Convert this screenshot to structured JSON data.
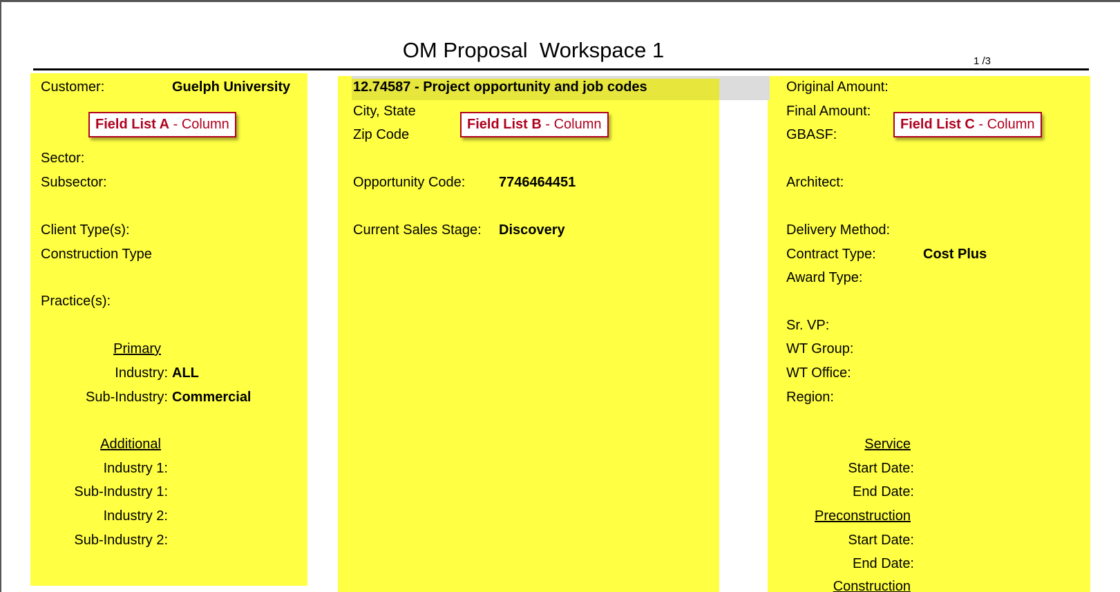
{
  "header": {
    "title": "OM Proposal  Workspace 1",
    "page_indicator": "1 /3"
  },
  "callouts": {
    "a": {
      "strong": "Field List A",
      "rest": " - Column"
    },
    "b": {
      "strong": "Field List B",
      "rest": " - Column"
    },
    "c": {
      "strong": "Field List C",
      "rest": " - Column"
    }
  },
  "column_a": {
    "customer_label": "Customer:",
    "customer_value": "Guelph University",
    "sector_label": "Sector:",
    "subsector_label": "Subsector:",
    "client_types_label": "Client Type(s):",
    "construction_type_label": "Construction Type",
    "practices_label": "Practice(s):",
    "primary_heading": "Primary",
    "industry_label": "Industry:",
    "industry_value": "ALL",
    "sub_industry_label": "Sub-Industry:",
    "sub_industry_value": "Commercial",
    "additional_heading": "Additional",
    "industry1_label": "Industry 1:",
    "sub_industry1_label": "Sub-Industry 1:",
    "industry2_label": "Industry 2:",
    "sub_industry2_label": "Sub-Industry 2:"
  },
  "column_b": {
    "project_heading": "12.74587 - Project opportunity and job codes",
    "city_state_label": "City, State",
    "zip_label": "Zip Code",
    "opportunity_code_label": "Opportunity Code:",
    "opportunity_code_value": "7746464451",
    "sales_stage_label": "Current Sales Stage:",
    "sales_stage_value": "Discovery"
  },
  "column_c": {
    "original_amount_label": "Original Amount:",
    "final_amount_label": "Final Amount:",
    "gbasf_label": "GBASF:",
    "architect_label": "Architect:",
    "delivery_method_label": "Delivery Method:",
    "contract_type_label": "Contract Type:",
    "contract_type_value": "Cost Plus",
    "award_type_label": "Award Type:",
    "sr_vp_label": "Sr. VP:",
    "wt_group_label": "WT Group:",
    "wt_office_label": "WT Office:",
    "region_label": "Region:",
    "service_heading": "Service",
    "service_start_label": "Start Date:",
    "service_end_label": "End Date:",
    "precon_heading": "Preconstruction",
    "precon_start_label": "Start Date:",
    "precon_end_label": "End Date:",
    "construction_heading": "Construction"
  },
  "colors": {
    "column_fill": "#ffff44",
    "callout_red": "#b0001e",
    "heading_bar_grey": "#dcdcdc"
  }
}
